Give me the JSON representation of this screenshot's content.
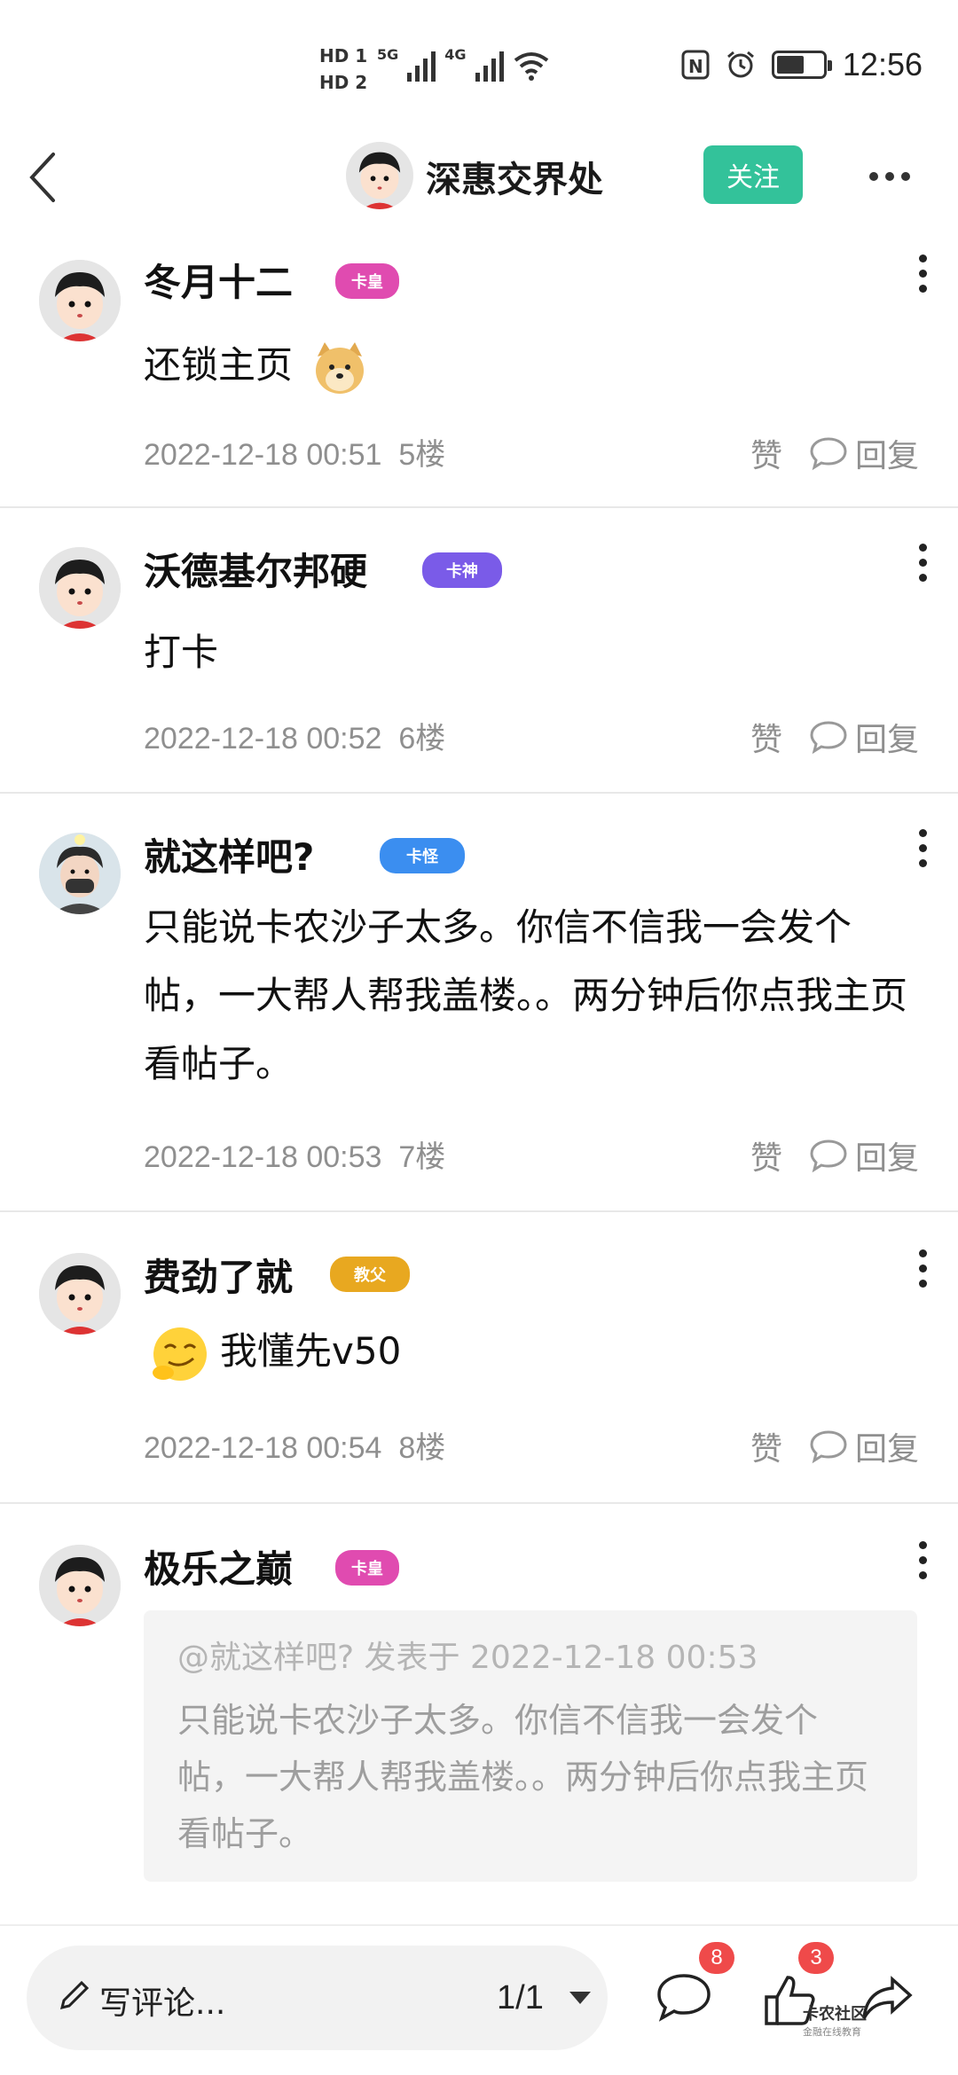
{
  "status_bar": {
    "hd1": "HD 1",
    "hd2": "HD 2",
    "net1": "5G",
    "net2": "4G",
    "time": "12:56",
    "battery_percent": 60
  },
  "header": {
    "title": "深惠交界处",
    "follow_label": "关注"
  },
  "comments": [
    {
      "username": "冬月十二",
      "badge": "卡皇",
      "badge_color": "#e04bb0",
      "text": "还锁主页",
      "emoji": "doge",
      "time": "2022-12-18 00:51",
      "floor": "5楼",
      "like_label": "赞",
      "reply_label": "回复"
    },
    {
      "username": "沃德基尔邦硬",
      "badge": "卡神",
      "badge_color": "#7a5be8",
      "text": "打卡",
      "time": "2022-12-18 00:52",
      "floor": "6楼",
      "like_label": "赞",
      "reply_label": "回复"
    },
    {
      "username": "就这样吧?",
      "badge": "卡怪",
      "badge_color": "#3b8ef0",
      "text": "只能说卡农沙子太多。你信不信我一会发个帖，一大帮人帮我盖楼。。两分钟后你点我主页看帖子。",
      "time": "2022-12-18 00:53",
      "floor": "7楼",
      "like_label": "赞",
      "reply_label": "回复"
    },
    {
      "username": "费劲了就",
      "badge": "教父",
      "badge_color": "#e8a820",
      "text": "我懂先v50",
      "emoji": "smirk",
      "time": "2022-12-18 00:54",
      "floor": "8楼",
      "like_label": "赞",
      "reply_label": "回复"
    },
    {
      "username": "极乐之巅",
      "badge": "卡皇",
      "badge_color": "#e04bb0",
      "quote_head": "@就这样吧?  发表于 2022-12-18 00:53",
      "quote_text": "只能说卡农沙子太多。你信不信我一会发个帖，一大帮人帮我盖楼。。两分钟后你点我主页看帖子。"
    }
  ],
  "bottom_bar": {
    "comment_placeholder": "写评论...",
    "page_indicator": "1/1",
    "comment_count": "8",
    "like_count": "3",
    "watermark": "卡农社区",
    "watermark_sub": "金融在线教育"
  },
  "colors": {
    "accent": "#33c29a",
    "meta_gray": "#8f8f8f",
    "badge_red": "#ef4a4a"
  }
}
